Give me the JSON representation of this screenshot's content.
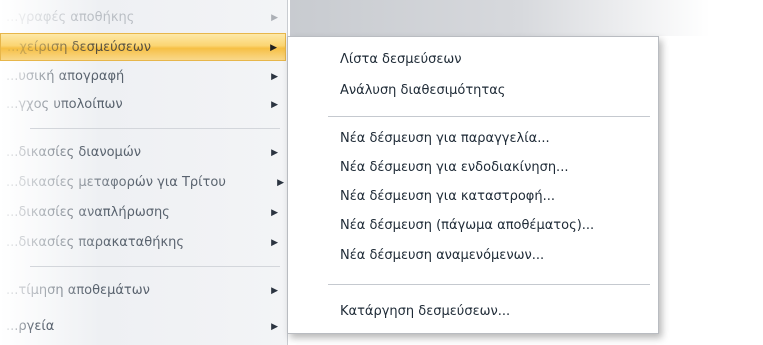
{
  "parent_menu": {
    "items": [
      {
        "label": "...γραφές αποθήκης",
        "arrow": "▶"
      },
      {
        "label": "...χείριση δεσμεύσεων",
        "arrow": "▶"
      },
      {
        "label": "...υσική απογραφή",
        "arrow": "▶"
      },
      {
        "label": "...γχος υπολοίπων",
        "arrow": "▶"
      },
      {
        "label": "...δικασίες διανομών",
        "arrow": "▶"
      },
      {
        "label": "...δικασίες μεταφορών για Τρίτου",
        "arrow": "▶"
      },
      {
        "label": "...δικασίες αναπλήρωσης",
        "arrow": "▶"
      },
      {
        "label": "...δικασίες παρακαταθήκης",
        "arrow": "▶"
      },
      {
        "label": "...τίμηση αποθεμάτων",
        "arrow": "▶"
      },
      {
        "label": "...ργεία",
        "arrow": "▶"
      }
    ],
    "highlight_color": "#f9d15f"
  },
  "submenu": {
    "items": [
      {
        "label": "Λίστα δεσμεύσεων"
      },
      {
        "label": "Ανάλυση διαθεσιμότητας"
      },
      {
        "label": "Νέα δέσμευση για παραγγελία..."
      },
      {
        "label": "Νέα δέσμευση για ενδοδιακίνηση..."
      },
      {
        "label": "Νέα δέσμευση για καταστροφή..."
      },
      {
        "label": "Νέα δέσμευση (πάγωμα αποθέματος)..."
      },
      {
        "label": "Νέα δέσμευση αναμενόμενων..."
      },
      {
        "label": "Κατάργηση δεσμεύσεων..."
      }
    ]
  }
}
